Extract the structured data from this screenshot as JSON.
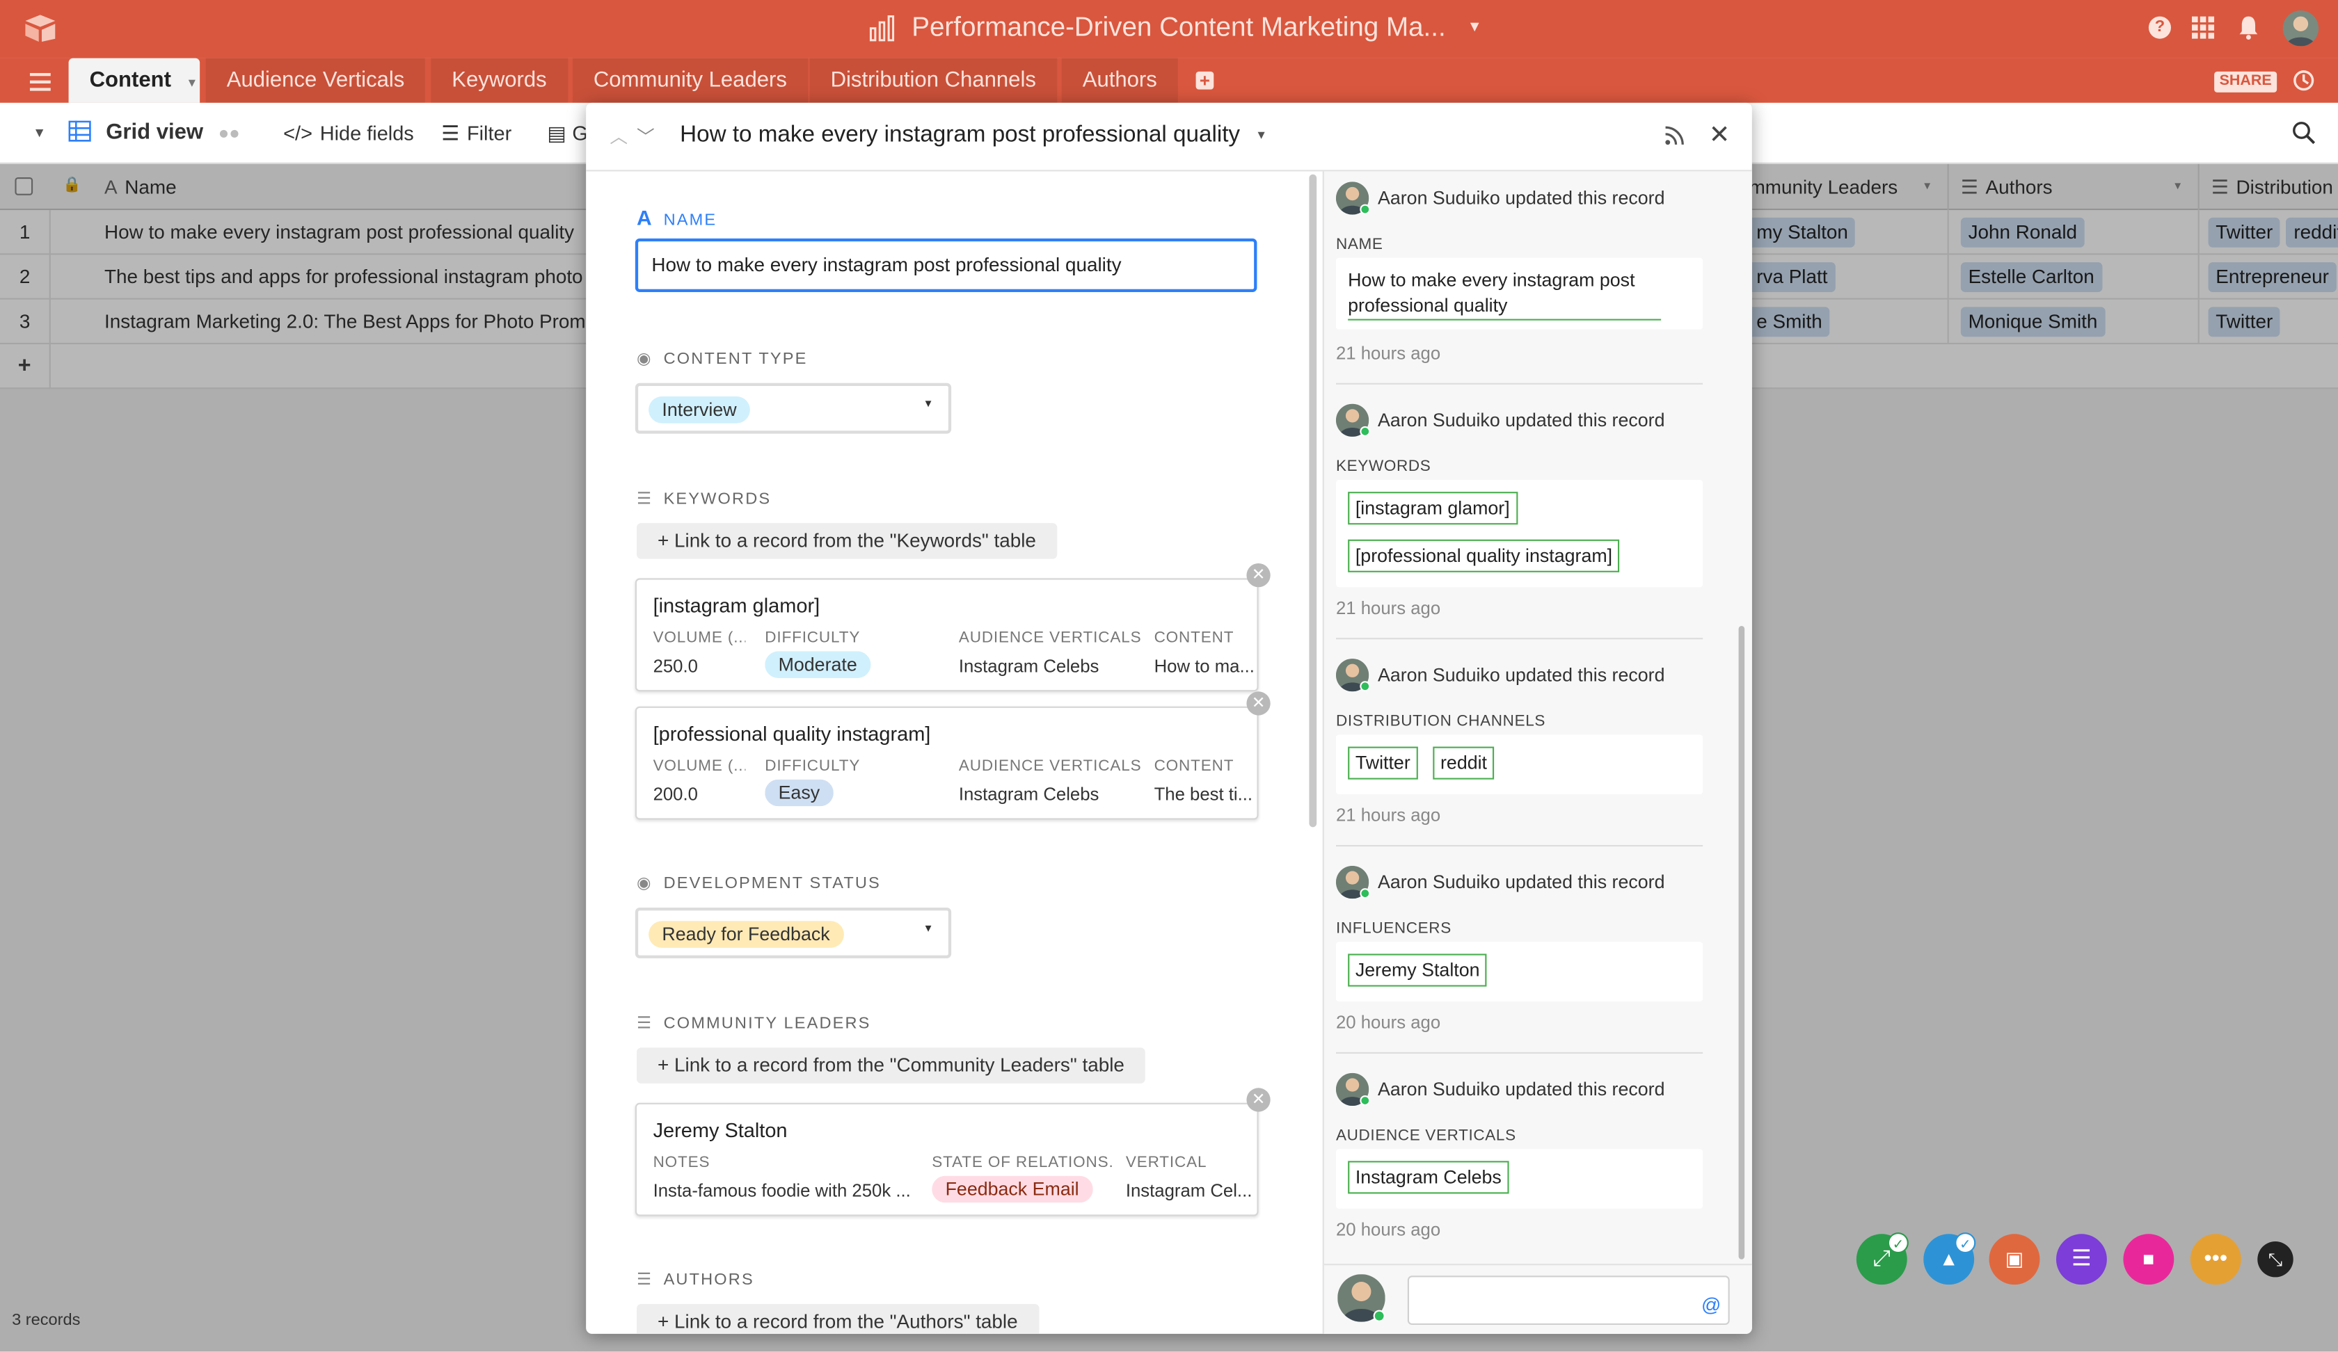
{
  "app": {
    "base_title": "Performance-Driven Content Marketing Ma...",
    "share_label": "SHARE"
  },
  "tabs": [
    {
      "label": "Content"
    },
    {
      "label": "Audience Verticals"
    },
    {
      "label": "Keywords"
    },
    {
      "label": "Community Leaders"
    },
    {
      "label": "Distribution Channels"
    },
    {
      "label": "Authors"
    }
  ],
  "toolbar": {
    "view_name": "Grid view",
    "hide_fields": "Hide fields",
    "filter": "Filter",
    "group_partial": "G"
  },
  "grid": {
    "columns": {
      "name": "Name",
      "community_leaders": "mmunity Leaders",
      "authors": "Authors",
      "distribution": "Distribution"
    },
    "rows": [
      {
        "num": "1",
        "name": "How to make every instagram post professional quality",
        "leader": "my Stalton",
        "author": "John Ronald",
        "dist": [
          "Twitter",
          "reddit"
        ]
      },
      {
        "num": "2",
        "name": "The best tips and apps for professional instagram photo",
        "leader": "rva Platt",
        "author": "Estelle Carlton",
        "dist": [
          "Entrepreneur"
        ]
      },
      {
        "num": "3",
        "name": "Instagram Marketing 2.0: The Best Apps for Photo Prom",
        "leader": "e Smith",
        "author": "Monique Smith",
        "dist": [
          "Twitter"
        ]
      }
    ],
    "add_row": "+",
    "record_count": "3 records"
  },
  "record": {
    "title": "How to make every instagram post professional quality",
    "fields": {
      "name_label": "NAME",
      "name_value": "How to make every instagram post professional quality",
      "content_type_label": "CONTENT TYPE",
      "content_type_value": "Interview",
      "keywords_label": "KEYWORDS",
      "keywords_link": "+ Link to a record from the \"Keywords\" table",
      "dev_status_label": "DEVELOPMENT STATUS",
      "dev_status_value": "Ready for Feedback",
      "community_label": "COMMUNITY LEADERS",
      "community_link": "+ Link to a record from the \"Community Leaders\" table",
      "authors_label": "AUTHORS",
      "authors_link": "+ Link to a record from the \"Authors\" table"
    },
    "keyword_cards": [
      {
        "title": "[instagram glamor]",
        "k1": "VOLUME (...",
        "k2": "DIFFICULTY",
        "k3": "AUDIENCE VERTICALS",
        "k4": "CONTENT",
        "v1": "250.0",
        "v2": "Moderate",
        "v3": "Instagram Celebs",
        "v4": "How to ma..."
      },
      {
        "title": "[professional quality instagram]",
        "k1": "VOLUME (...",
        "k2": "DIFFICULTY",
        "k3": "AUDIENCE VERTICALS",
        "k4": "CONTENT",
        "v1": "200.0",
        "v2": "Easy",
        "v3": "Instagram Celebs",
        "v4": "The best ti..."
      }
    ],
    "leader_card": {
      "title": "Jeremy Stalton",
      "k1": "NOTES",
      "k2": "STATE OF RELATIONS...",
      "k3": "VERTICAL",
      "v1": "Insta-famous foodie with 250k ...",
      "v2": "Feedback Email",
      "v3": "Instagram Cel..."
    }
  },
  "activity": [
    {
      "who": "Aaron Suduiko updated this record",
      "field": "NAME",
      "values": [
        "How to make every instagram post professional quality"
      ],
      "time": "21 hours ago"
    },
    {
      "who": "Aaron Suduiko updated this record",
      "field": "KEYWORDS",
      "values": [
        "[instagram glamor]",
        "[professional quality instagram]"
      ],
      "time": "21 hours ago"
    },
    {
      "who": "Aaron Suduiko updated this record",
      "field": "DISTRIBUTION CHANNELS",
      "values": [
        "Twitter",
        "reddit"
      ],
      "time": "21 hours ago"
    },
    {
      "who": "Aaron Suduiko updated this record",
      "field": "INFLUENCERS",
      "values": [
        "Jeremy Stalton"
      ],
      "time": "20 hours ago"
    },
    {
      "who": "Aaron Suduiko updated this record",
      "field": "AUDIENCE VERTICALS",
      "values": [
        "Instagram Celebs"
      ],
      "time": "20 hours ago"
    }
  ],
  "comment": {
    "placeholder": "",
    "mention_icon": "@"
  },
  "colors": {
    "brand": "#d9573e",
    "link_blue": "#2d7ff9",
    "green": "#4caf50"
  }
}
